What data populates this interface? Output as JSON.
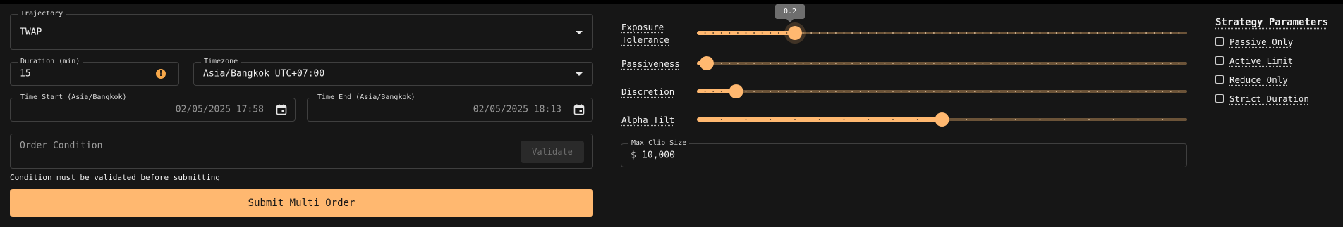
{
  "order_form": {
    "trajectory": {
      "label": "Trajectory",
      "value": "TWAP"
    },
    "duration": {
      "label": "Duration (min)",
      "value": "15"
    },
    "timezone": {
      "label": "Timezone",
      "value": "Asia/Bangkok UTC+07:00"
    },
    "time_start": {
      "label": "Time Start (Asia/Bangkok)",
      "value": "02/05/2025 17:58"
    },
    "time_end": {
      "label": "Time End (Asia/Bangkok)",
      "value": "02/05/2025 18:13"
    },
    "order_condition": {
      "placeholder": "Order Condition",
      "validate_label": "Validate"
    },
    "hint": "Condition must be validated before submitting",
    "submit_label": "Submit Multi Order"
  },
  "sliders": [
    {
      "label_lines": [
        "Exposure",
        "Tolerance"
      ],
      "value": 0.2,
      "tooltip": "0.2"
    },
    {
      "label_lines": [
        "Passiveness"
      ],
      "value": 0.02
    },
    {
      "label_lines": [
        "Discretion"
      ],
      "value": 0.08
    },
    {
      "label_lines": [
        "Alpha Tilt"
      ],
      "value": 0.5
    }
  ],
  "max_clip": {
    "label": "Max Clip Size",
    "prefix": "$",
    "value": "10,000"
  },
  "strategy": {
    "title": "Strategy Parameters",
    "options": [
      {
        "label": "Passive Only",
        "checked": false
      },
      {
        "label": "Active Limit",
        "checked": false
      },
      {
        "label": "Reduce Only",
        "checked": false
      },
      {
        "label": "Strict Duration",
        "checked": false
      }
    ]
  },
  "colors": {
    "accent": "#ffb870",
    "background": "#161616",
    "border": "#3f3f3f"
  }
}
